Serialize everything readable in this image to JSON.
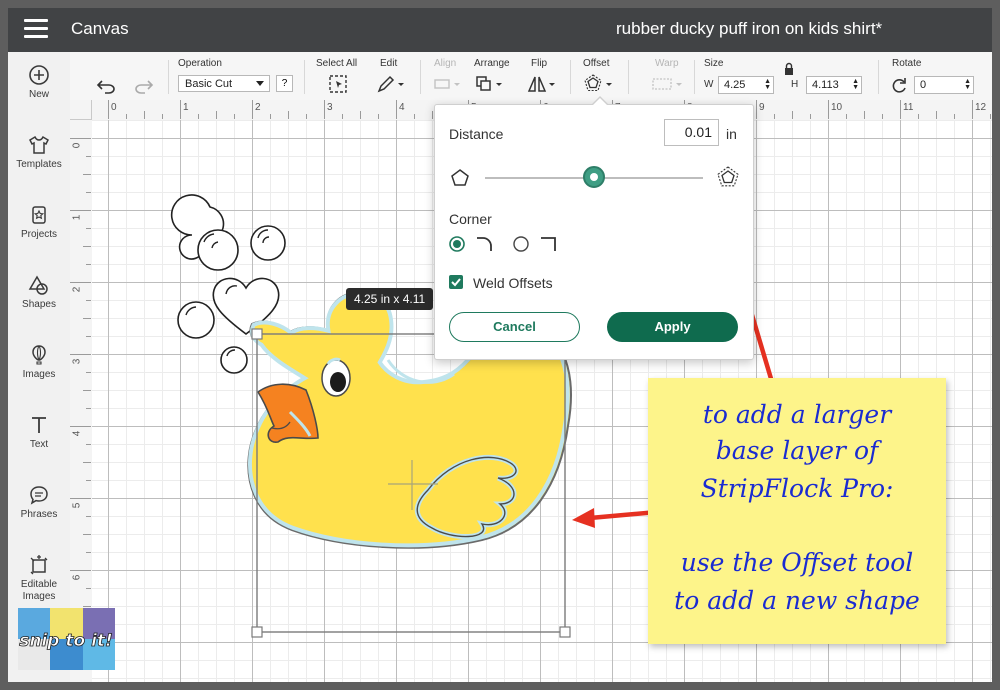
{
  "header": {
    "app_title": "Canvas",
    "project_title": "rubber ducky puff iron on kids shirt*"
  },
  "sidebar": {
    "items": [
      {
        "label": "New",
        "icon": "plus-circle-icon"
      },
      {
        "label": "Templates",
        "icon": "shirt-icon"
      },
      {
        "label": "Projects",
        "icon": "projects-icon"
      },
      {
        "label": "Shapes",
        "icon": "shapes-icon"
      },
      {
        "label": "Images",
        "icon": "balloon-icon"
      },
      {
        "label": "Text",
        "icon": "text-icon"
      },
      {
        "label": "Phrases",
        "icon": "speech-bubble-icon"
      },
      {
        "label": "Editable Images",
        "icon": "editable-images-icon"
      }
    ]
  },
  "toolbar": {
    "operation_label": "Operation",
    "operation_value": "Basic Cut",
    "help_label": "?",
    "select_all_label": "Select All",
    "edit_label": "Edit",
    "align_label": "Align",
    "arrange_label": "Arrange",
    "flip_label": "Flip",
    "offset_label": "Offset",
    "warp_label": "Warp",
    "size_label": "Size",
    "w_label": "W",
    "w_value": "4.25",
    "h_label": "H",
    "h_value": "4.113",
    "rotate_label": "Rotate",
    "rotate_value": "0"
  },
  "ruler": {
    "top": [
      "0",
      "1",
      "2",
      "3",
      "4",
      "5",
      "6",
      "7",
      "8",
      "9",
      "10",
      "11",
      "12"
    ],
    "left": [
      "0",
      "1",
      "2",
      "3",
      "4",
      "5",
      "6"
    ]
  },
  "selection": {
    "dimensions": "4.25  in x 4.11"
  },
  "offset_popup": {
    "distance_label": "Distance",
    "distance_value": "0.01",
    "distance_unit": "in",
    "slider_value_fraction": 0.5,
    "corner_label": "Corner",
    "corner_selected": "rounded",
    "weld_label": "Weld Offsets",
    "weld_checked": true,
    "cancel_label": "Cancel",
    "apply_label": "Apply"
  },
  "annotation": {
    "lines": [
      "to add a larger",
      "base layer of",
      "StripFlock Pro:",
      "",
      "use the Offset tool",
      "to add a new shape"
    ]
  },
  "watermark": {
    "text": "snip to it!"
  },
  "colors": {
    "header": "#414345",
    "accent_green": "#0f6b4e",
    "duck_yellow": "#ffe14d",
    "beak_orange": "#f58220",
    "offset_outline": "#bfe4ec",
    "sticky_note": "#fdf48a",
    "arrow_red": "#e63121",
    "annotation_text": "#1a2bd1"
  }
}
